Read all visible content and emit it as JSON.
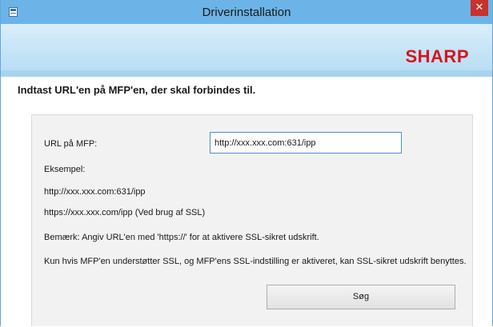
{
  "window": {
    "title": "Driverinstallation",
    "close_glyph": "✕",
    "icon": "installer-window-icon"
  },
  "banner": {
    "logo_text": "SHARP",
    "logo_color": "#d8131c"
  },
  "page": {
    "heading": "Indtast URL'en på MFP'en, der skal forbindes til."
  },
  "form": {
    "url_label": "URL på MFP:",
    "url_value": "http://xxx.xxx.com:631/ipp",
    "example_title": "Eksempel:",
    "example_1": "http://xxx.xxx.com:631/ipp",
    "example_2": "https://xxx.xxx.com/ipp (Ved brug af SSL)",
    "note": "Bemærk: Angiv URL'en med 'https://' for at aktivere SSL-sikret udskrift.",
    "info": "Kun hvis MFP'en understøtter SSL, og MFP'ens SSL-indstilling er aktiveret, kan SSL-sikret udskrift benyttes.",
    "search_label": "Søg"
  },
  "colors": {
    "titlebar": "#6cb4e8",
    "close_button": "#c7322c",
    "accent_border": "#4a8fd4"
  }
}
